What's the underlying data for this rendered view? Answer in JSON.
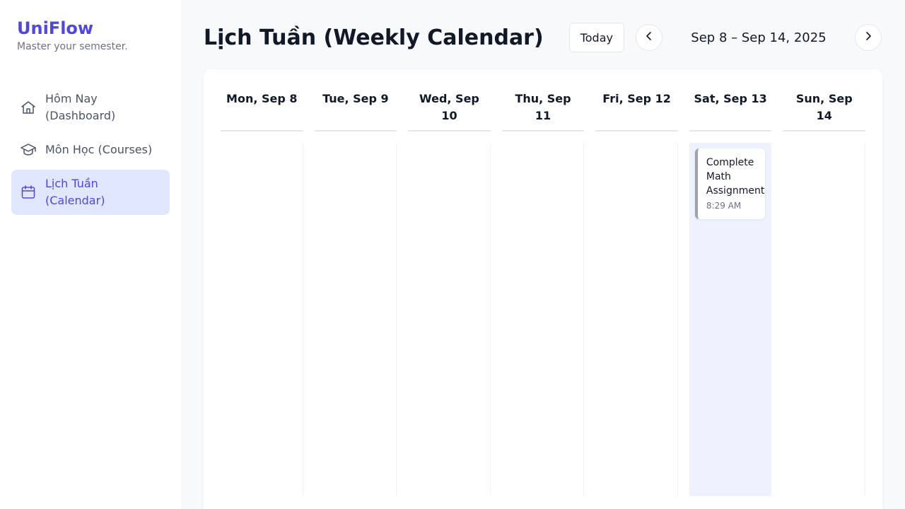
{
  "brand": {
    "name": "UniFlow",
    "tagline": "Master your semester."
  },
  "sidebar": {
    "items": [
      {
        "label": "Hôm Nay (Dashboard)",
        "icon": "home-icon",
        "active": false
      },
      {
        "label": "Môn Học (Courses)",
        "icon": "graduation-cap-icon",
        "active": false
      },
      {
        "label": "Lịch Tuần (Calendar)",
        "icon": "calendar-icon",
        "active": true
      }
    ]
  },
  "header": {
    "title": "Lịch Tuần (Weekly Calendar)",
    "today_label": "Today",
    "date_range": "Sep 8 – Sep 14, 2025"
  },
  "calendar": {
    "days": [
      {
        "label": "Mon, Sep 8"
      },
      {
        "label": "Tue, Sep 9"
      },
      {
        "label": "Wed, Sep 10"
      },
      {
        "label": "Thu, Sep 11"
      },
      {
        "label": "Fri, Sep 12"
      },
      {
        "label": "Sat, Sep 13",
        "highlighted": true,
        "events": [
          {
            "title": "Complete Math Assignment",
            "time": "8:29 AM"
          }
        ]
      },
      {
        "label": "Sun, Sep 14"
      }
    ]
  },
  "colors": {
    "accent": "#4f46e5",
    "active_bg": "#e0e7ff",
    "today_column_bg": "#eef2ff",
    "event_border": "#9ca3af"
  }
}
